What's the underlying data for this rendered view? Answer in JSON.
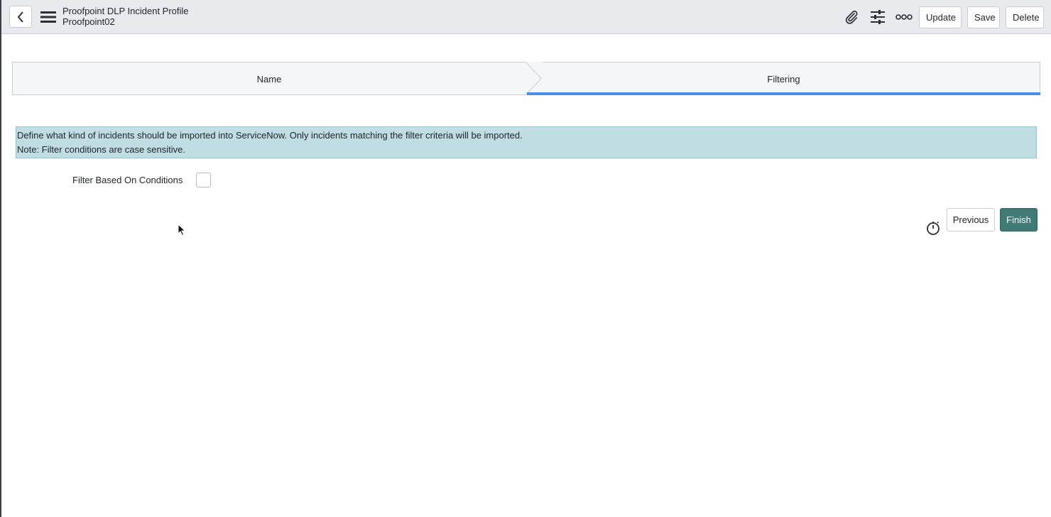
{
  "header": {
    "title": "Proofpoint DLP Incident Profile",
    "subtitle": "Proofpoint02",
    "update_label": "Update",
    "save_label": "Save",
    "delete_label": "Delete",
    "icons": [
      "back-icon",
      "menu-icon",
      "paperclip-icon",
      "sliders-icon",
      "more-icon"
    ]
  },
  "stepper": {
    "steps": [
      {
        "label": "Name",
        "active": false
      },
      {
        "label": "Filtering",
        "active": true
      }
    ],
    "active_color": "#4a8fe7"
  },
  "info": {
    "line1": "Define what kind of incidents should be imported into ServiceNow. Only incidents matching the filter criteria will be imported.",
    "line2": "Note: Filter conditions are case sensitive.",
    "background": "#bfdde3"
  },
  "form": {
    "filter_label": "Filter Based On Conditions",
    "filter_checked": false
  },
  "footer": {
    "previous_label": "Previous",
    "finish_label": "Finish",
    "finish_color": "#3f7b74",
    "timer_icon": "timer-icon"
  }
}
